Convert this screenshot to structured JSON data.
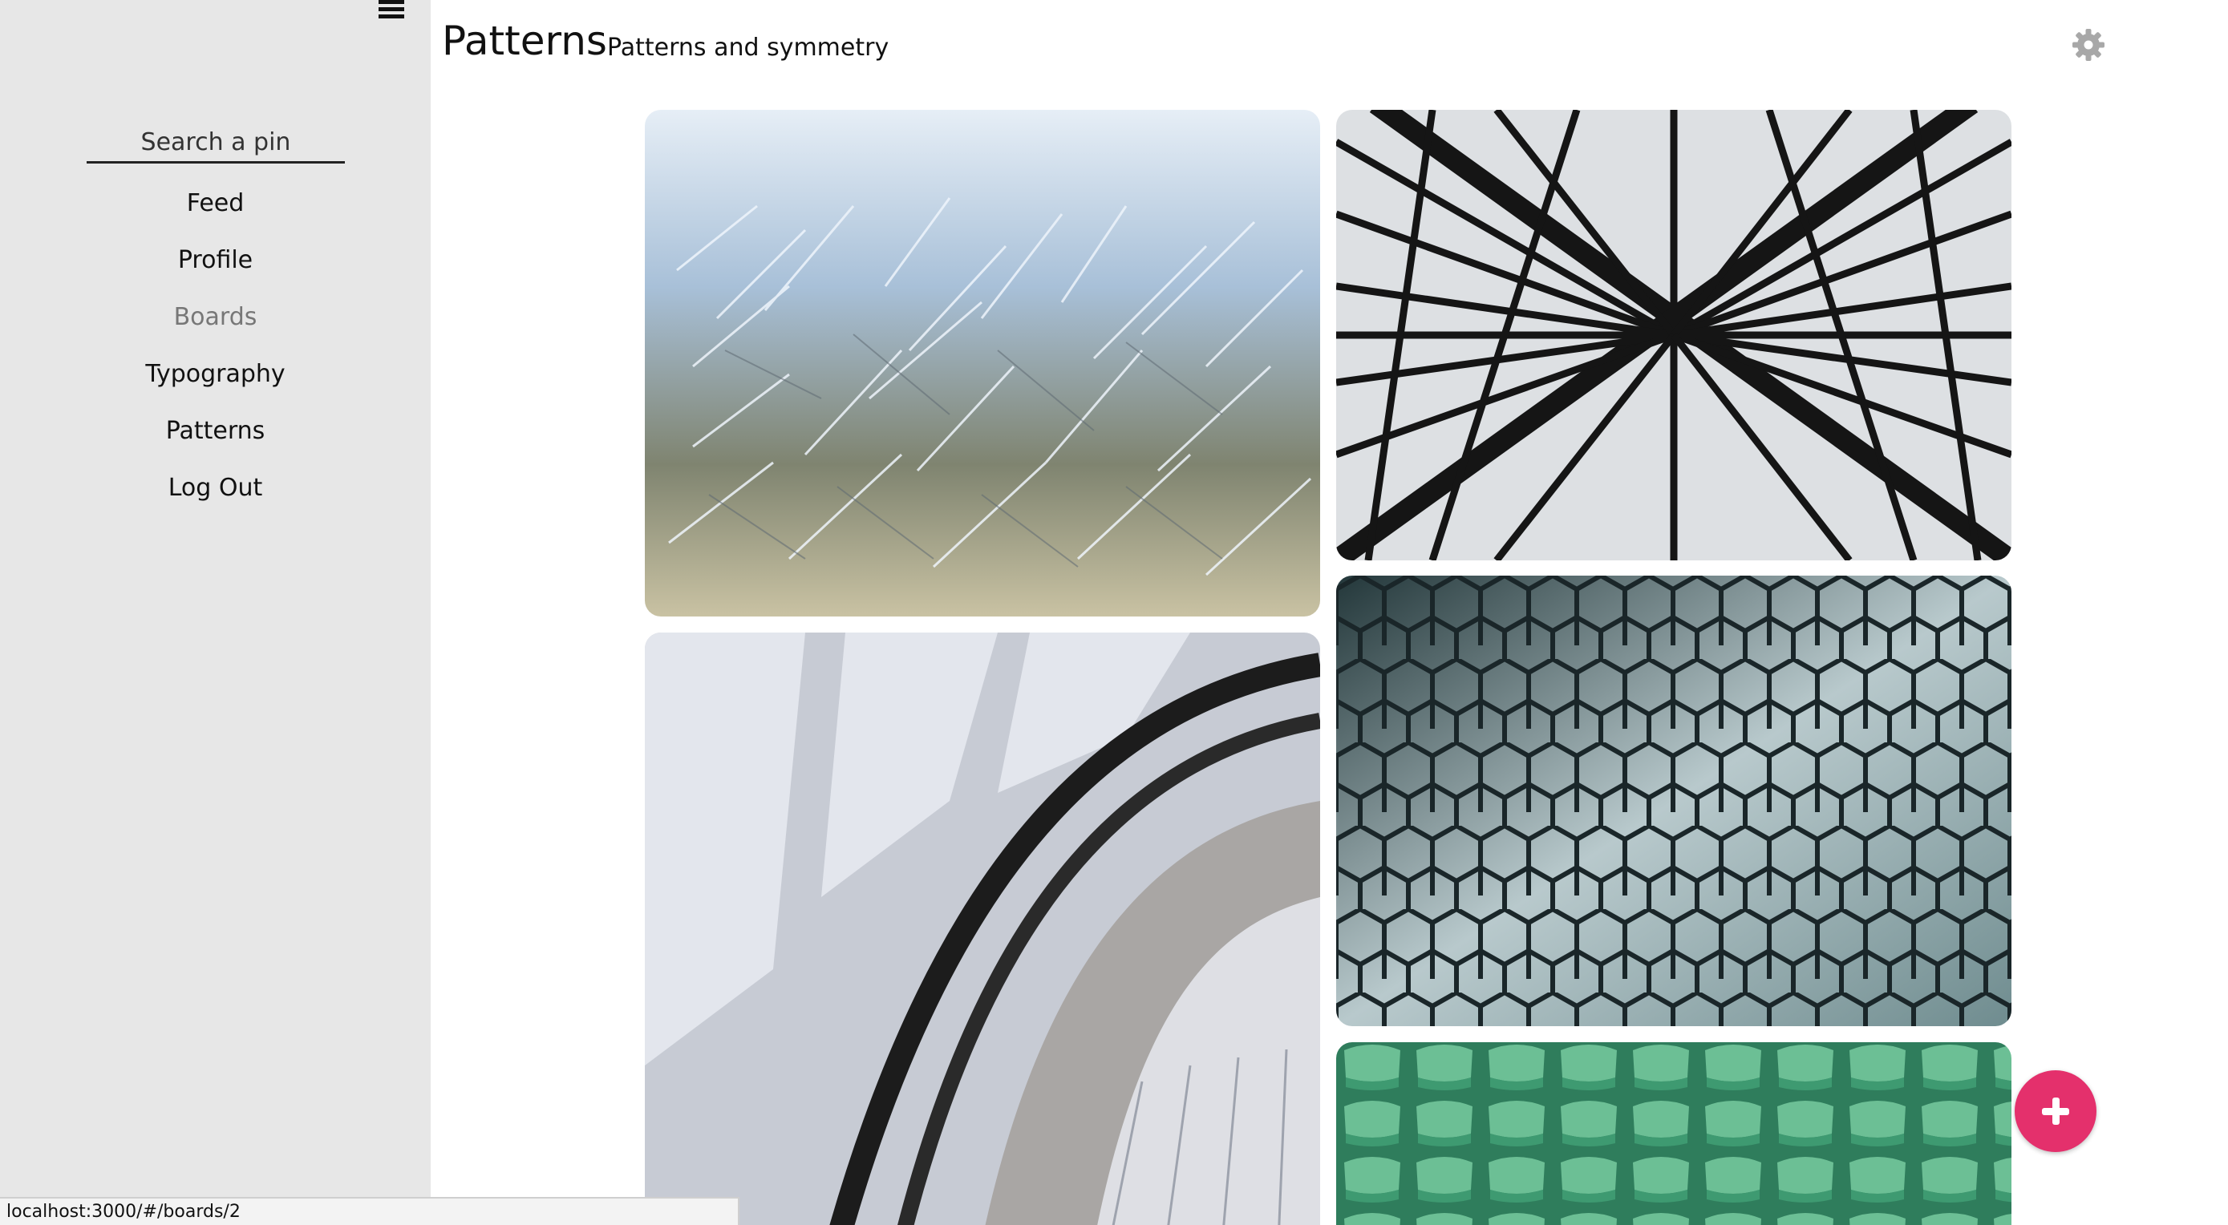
{
  "sidebar": {
    "menu_icon": "hamburger-menu-icon",
    "search": {
      "placeholder": "Search a pin",
      "value": ""
    },
    "items": [
      {
        "label": "Feed"
      },
      {
        "label": "Profile"
      },
      {
        "label": "Boards",
        "active": true
      },
      {
        "label": "Typography"
      },
      {
        "label": "Patterns"
      },
      {
        "label": "Log Out"
      }
    ]
  },
  "header": {
    "title": "Patterns",
    "subtitle": "Patterns and symmetry",
    "settings_icon": "gear-icon"
  },
  "pins": [
    {
      "subject": "frost-crystals"
    },
    {
      "subject": "steel-lattice"
    },
    {
      "subject": "spiral-staircase"
    },
    {
      "subject": "hexagonal-glass-facade"
    },
    {
      "subject": "green-stadium-seats"
    }
  ],
  "fab": {
    "icon": "plus-icon"
  },
  "status_bar": {
    "url": "localhost:3000/#/boards/2"
  },
  "colors": {
    "sidebar_bg": "#e7e7e7",
    "accent": "#e4306c",
    "muted_text": "#777777"
  }
}
